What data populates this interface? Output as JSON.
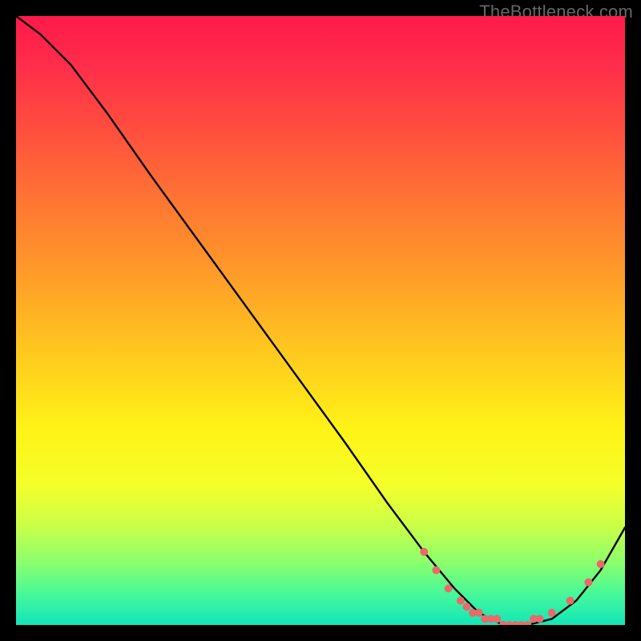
{
  "watermark": "TheBottleneck.com",
  "chart_data": {
    "type": "line",
    "title": "",
    "xlabel": "",
    "ylabel": "",
    "xlim": [
      0,
      100
    ],
    "ylim": [
      0,
      100
    ],
    "grid": false,
    "legend": false,
    "background_gradient": {
      "stops": [
        {
          "offset": 0.0,
          "color": "#ff1a4b"
        },
        {
          "offset": 0.08,
          "color": "#ff2d4a"
        },
        {
          "offset": 0.18,
          "color": "#ff4c3f"
        },
        {
          "offset": 0.3,
          "color": "#ff7433"
        },
        {
          "offset": 0.42,
          "color": "#ff9a29"
        },
        {
          "offset": 0.55,
          "color": "#ffc81f"
        },
        {
          "offset": 0.68,
          "color": "#fff317"
        },
        {
          "offset": 0.77,
          "color": "#f4ff2a"
        },
        {
          "offset": 0.84,
          "color": "#c8ff4a"
        },
        {
          "offset": 0.9,
          "color": "#88ff6e"
        },
        {
          "offset": 0.95,
          "color": "#46f89a"
        },
        {
          "offset": 1.0,
          "color": "#12e6b8"
        }
      ]
    },
    "series": [
      {
        "name": "bottleneck-curve",
        "color": "#000000",
        "x": [
          0,
          4,
          9,
          15,
          22,
          30,
          38,
          46,
          54,
          61,
          67,
          72,
          76,
          80,
          84,
          88,
          92,
          96,
          100
        ],
        "y": [
          100,
          97,
          92,
          84,
          74,
          63,
          52,
          41,
          30,
          20,
          12,
          6,
          2,
          0,
          0,
          1,
          4,
          9,
          16
        ]
      }
    ],
    "marker_cluster": {
      "color": "#e86a6a",
      "radius": 5,
      "points": [
        {
          "x": 67,
          "y": 12
        },
        {
          "x": 69,
          "y": 9
        },
        {
          "x": 71,
          "y": 6
        },
        {
          "x": 73,
          "y": 4
        },
        {
          "x": 74,
          "y": 3
        },
        {
          "x": 75,
          "y": 2
        },
        {
          "x": 76,
          "y": 2
        },
        {
          "x": 77,
          "y": 1
        },
        {
          "x": 78,
          "y": 1
        },
        {
          "x": 79,
          "y": 1
        },
        {
          "x": 80,
          "y": 0
        },
        {
          "x": 81,
          "y": 0
        },
        {
          "x": 82,
          "y": 0
        },
        {
          "x": 83,
          "y": 0
        },
        {
          "x": 84,
          "y": 0
        },
        {
          "x": 85,
          "y": 1
        },
        {
          "x": 86,
          "y": 1
        },
        {
          "x": 88,
          "y": 2
        },
        {
          "x": 91,
          "y": 4
        },
        {
          "x": 94,
          "y": 7
        },
        {
          "x": 96,
          "y": 10
        }
      ]
    }
  }
}
